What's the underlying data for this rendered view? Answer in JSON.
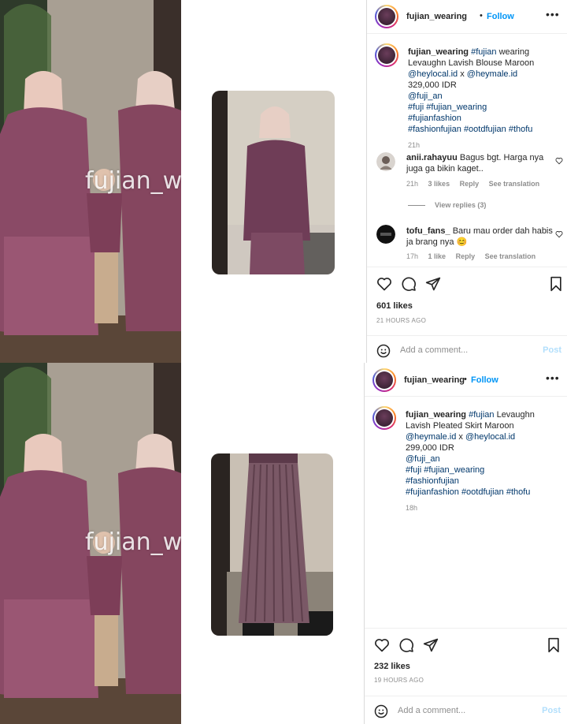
{
  "watermark": "fujian_wearing",
  "post1": {
    "username": "fujian_wearing",
    "follow": "Follow",
    "caption": {
      "user": "fujian_wearing",
      "tag1": "#fujian",
      "text1": " wearing Levaughn Lavish Blouse Maroon",
      "mention1": "@heylocal.id",
      "x": " x ",
      "mention2": "@heymale.id",
      "price": "329,000 IDR",
      "mention3": "@fuji_an",
      "hashtags1": "#fuji #fujian_wearing #fujianfashion",
      "hashtags2": "#fashionfujian #ootdfujian #thofu",
      "time": "21h"
    },
    "comments": [
      {
        "user": "anii.rahayuu",
        "text": "Bagus bgt. Harga nya juga ga bikin kaget..",
        "time": "21h",
        "likes": "3 likes",
        "reply": "Reply",
        "translate": "See translation",
        "view_replies": "View replies (3)"
      },
      {
        "user": "tofu_fans_",
        "text": "Baru mau order dah habis ja brang nya 😊",
        "time": "17h",
        "likes": "1 like",
        "reply": "Reply",
        "translate": "See translation"
      }
    ],
    "likes": "601 likes",
    "ago": "21 HOURS AGO",
    "add_comment": "Add a comment...",
    "post_btn": "Post"
  },
  "post2": {
    "username": "fujian_wearing",
    "follow": "Follow",
    "caption": {
      "user": "fujian_wearing",
      "tag1": "#fujian",
      "text1": " Levaughn Lavish Pleated Skirt Maroon",
      "mention1": "@heymale.id",
      "x": " x ",
      "mention2": "@heylocal.id",
      "price": "299,000 IDR",
      "mention3": "@fuji_an",
      "hashtags1": "#fuji #fujian_wearing #fashionfujian",
      "hashtags2": "#fujianfashion #ootdfujian #thofu",
      "time": "18h"
    },
    "likes": "232 likes",
    "ago": "19 HOURS AGO",
    "add_comment": "Add a comment...",
    "post_btn": "Post"
  },
  "colors": {
    "link": "#0095f6",
    "hashtag": "#00376b",
    "muted": "#8e8e8e",
    "maroon": "#8a4a66"
  }
}
